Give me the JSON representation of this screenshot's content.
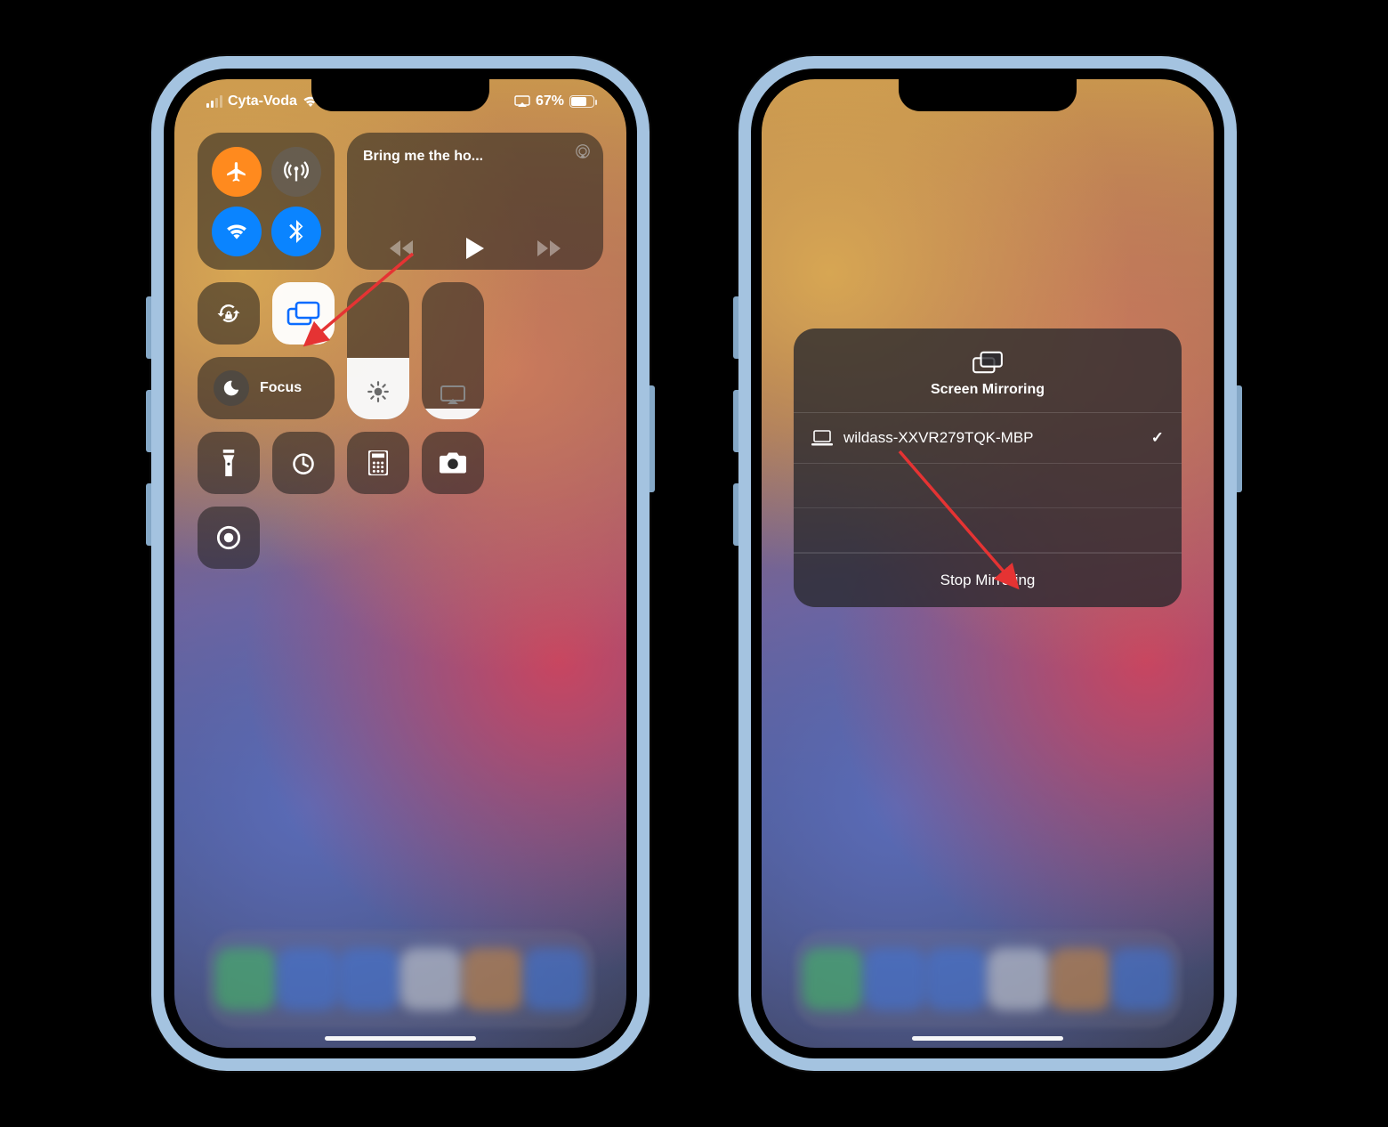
{
  "status": {
    "carrier": "Cyta-Voda",
    "battery_pct": "67%"
  },
  "control_center": {
    "media_title": "Bring me the ho...",
    "focus_label": "Focus"
  },
  "mirroring_sheet": {
    "title": "Screen Mirroring",
    "device_name": "wildass-XXVR279TQK-MBP",
    "stop_label": "Stop Mirroring"
  }
}
